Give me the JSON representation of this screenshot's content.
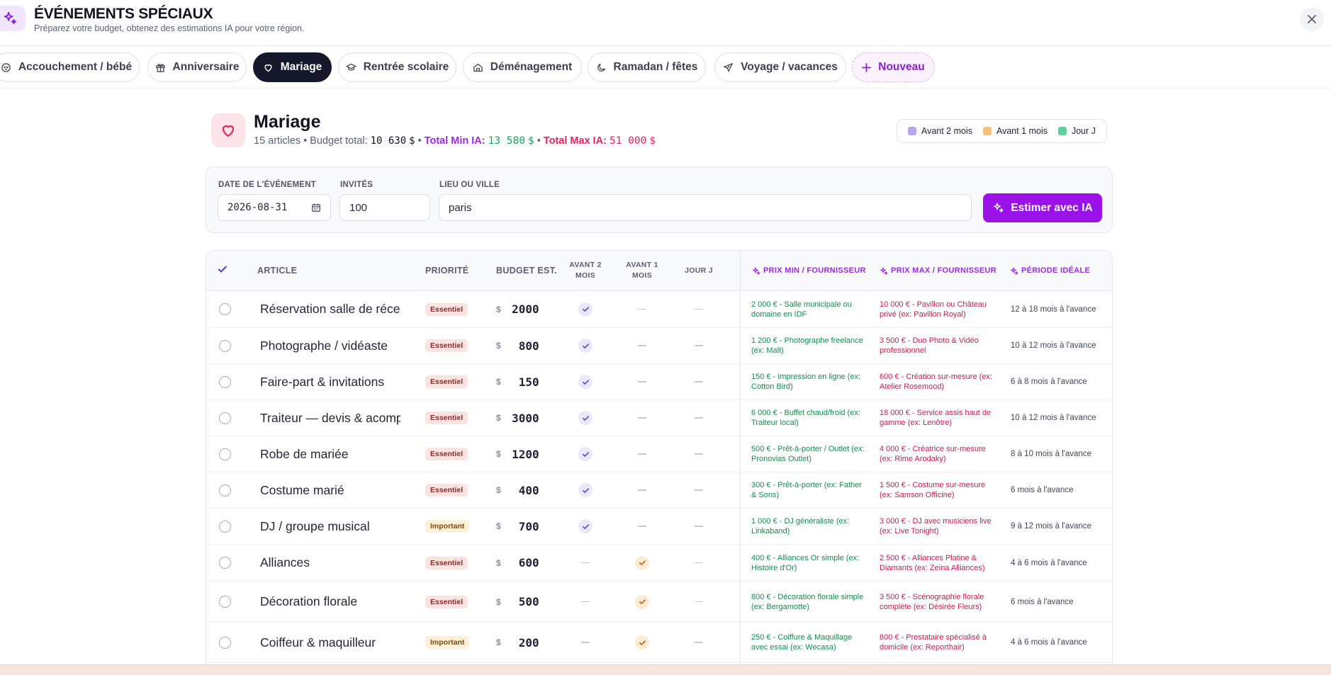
{
  "header": {
    "title": "ÉVÉNEMENTS SPÉCIAUX",
    "subtitle": "Préparez votre budget, obtenez des estimations IA pour votre région."
  },
  "tabs": [
    {
      "label": "Accouchement / bébé",
      "icon": "baby-icon",
      "active": false
    },
    {
      "label": "Anniversaire",
      "icon": "gift-icon",
      "active": false
    },
    {
      "label": "Mariage",
      "icon": "heart-icon",
      "active": true
    },
    {
      "label": "Rentrée scolaire",
      "icon": "graduation-cap-icon",
      "active": false
    },
    {
      "label": "Déménagement",
      "icon": "home-icon",
      "active": false
    },
    {
      "label": "Ramadan / fêtes",
      "icon": "moon-icon",
      "active": false
    },
    {
      "label": "Voyage / vacances",
      "icon": "plane-icon",
      "active": false
    },
    {
      "label": "Nouveau",
      "icon": "plus-icon",
      "active": false
    }
  ],
  "event": {
    "title": "Mariage",
    "count_text": "15 articles",
    "budget_label": "Budget total:",
    "budget_value": "10 630",
    "currency": "$",
    "min_label": "Total Min IA:",
    "min_value": "13 580",
    "max_label": "Total Max IA:",
    "max_value": "51 000"
  },
  "legend": [
    {
      "label": "Avant 2 mois",
      "color": "#b4a6f0"
    },
    {
      "label": "Avant 1 mois",
      "color": "#f6c27a"
    },
    {
      "label": "Jour J",
      "color": "#5fcf9e"
    }
  ],
  "form": {
    "date_label": "DATE DE L'ÉVÉNEMENT",
    "date_value": "2026-08-31",
    "guests_label": "INVITÉS",
    "guests_value": "100",
    "place_label": "LIEU OU VILLE",
    "place_value": "paris",
    "estimate_label": "Estimer avec IA"
  },
  "table": {
    "headers": {
      "article": "ARTICLE",
      "priority": "PRIORITÉ",
      "budget": "BUDGET EST.",
      "before2": "AVANT 2 MOIS",
      "before1": "AVANT 1 MOIS",
      "dday": "JOUR J",
      "min": "PRIX MIN / FOURNISSEUR",
      "max": "PRIX MAX / FOURNISSEUR",
      "period": "PÉRIODE IDÉALE"
    },
    "rows": [
      {
        "article": "Réservation salle de réception",
        "priority": "Essentiel",
        "budget": "2000",
        "timing": "before2",
        "min": "2 000 € - Salle municipale ou domaine en IDF",
        "max": "10 000 € - Pavillon ou Château privé (ex: Pavillon Royal)",
        "period": "12 à 18 mois à l'avance"
      },
      {
        "article": "Photographe / vidéaste",
        "priority": "Essentiel",
        "budget": "800",
        "timing": "before2",
        "min": "1 200 € - Photographe freelance (ex: Malt)",
        "max": "3 500 € - Duo Photo & Vidéo professionnel",
        "period": "10 à 12 mois à l'avance"
      },
      {
        "article": "Faire-part & invitations",
        "priority": "Essentiel",
        "budget": "150",
        "timing": "before2",
        "min": "150 € - Impression en ligne (ex: Cotton Bird)",
        "max": "600 € - Création sur-mesure (ex: Atelier Rosemood)",
        "period": "6 à 8 mois à l'avance"
      },
      {
        "article": "Traiteur — devis & acompte",
        "priority": "Essentiel",
        "budget": "3000",
        "timing": "before2",
        "min": "6 000 € - Buffet chaud/froid (ex: Traiteur local)",
        "max": "18 000 € - Service assis haut de gamme (ex: Lenôtre)",
        "period": "10 à 12 mois à l'avance"
      },
      {
        "article": "Robe de mariée",
        "priority": "Essentiel",
        "budget": "1200",
        "timing": "before2",
        "min": "500 € - Prêt-à-porter / Outlet (ex: Pronovias Outlet)",
        "max": "4 000 € - Créatrice sur-mesure (ex: Rime Arodaky)",
        "period": "8 à 10 mois à l'avance"
      },
      {
        "article": "Costume marié",
        "priority": "Essentiel",
        "budget": "400",
        "timing": "before2",
        "min": "300 € - Prêt-à-porter (ex: Father & Sons)",
        "max": "1 500 € - Costume sur-mesure (ex: Samson Officine)",
        "period": "6 mois à l'avance"
      },
      {
        "article": "DJ / groupe musical",
        "priority": "Important",
        "budget": "700",
        "timing": "before2",
        "min": "1 000 € - DJ généraliste (ex: Linkaband)",
        "max": "3 000 € - DJ avec musiciens live (ex: Live Tonight)",
        "period": "9 à 12 mois à l'avance"
      },
      {
        "article": "Alliances",
        "priority": "Essentiel",
        "budget": "600",
        "timing": "before1",
        "min": "400 € - Alliances Or simple (ex: Histoire d'Or)",
        "max": "2 500 € - Alliances Platine & Diamants (ex: Zeina Alliances)",
        "period": "4 à 6 mois à l'avance"
      },
      {
        "article": "Décoration florale",
        "priority": "Essentiel",
        "budget": "500",
        "timing": "before1",
        "min": "800 € - Décoration florale simple (ex: Bergamotte)",
        "max": "3 500 € - Scénographie florale complète (ex: Désirée Fleurs)",
        "period": "6 mois à l'avance"
      },
      {
        "article": "Coiffeur & maquilleur",
        "priority": "Important",
        "budget": "200",
        "timing": "before1",
        "min": "250 € - Coiffure & Maquillage avec essai (ex: Wecasa)",
        "max": "800 € - Prestataire spécialisé à domicile (ex: Reporthair)",
        "period": "4 à 6 mois à l'avance"
      }
    ]
  }
}
